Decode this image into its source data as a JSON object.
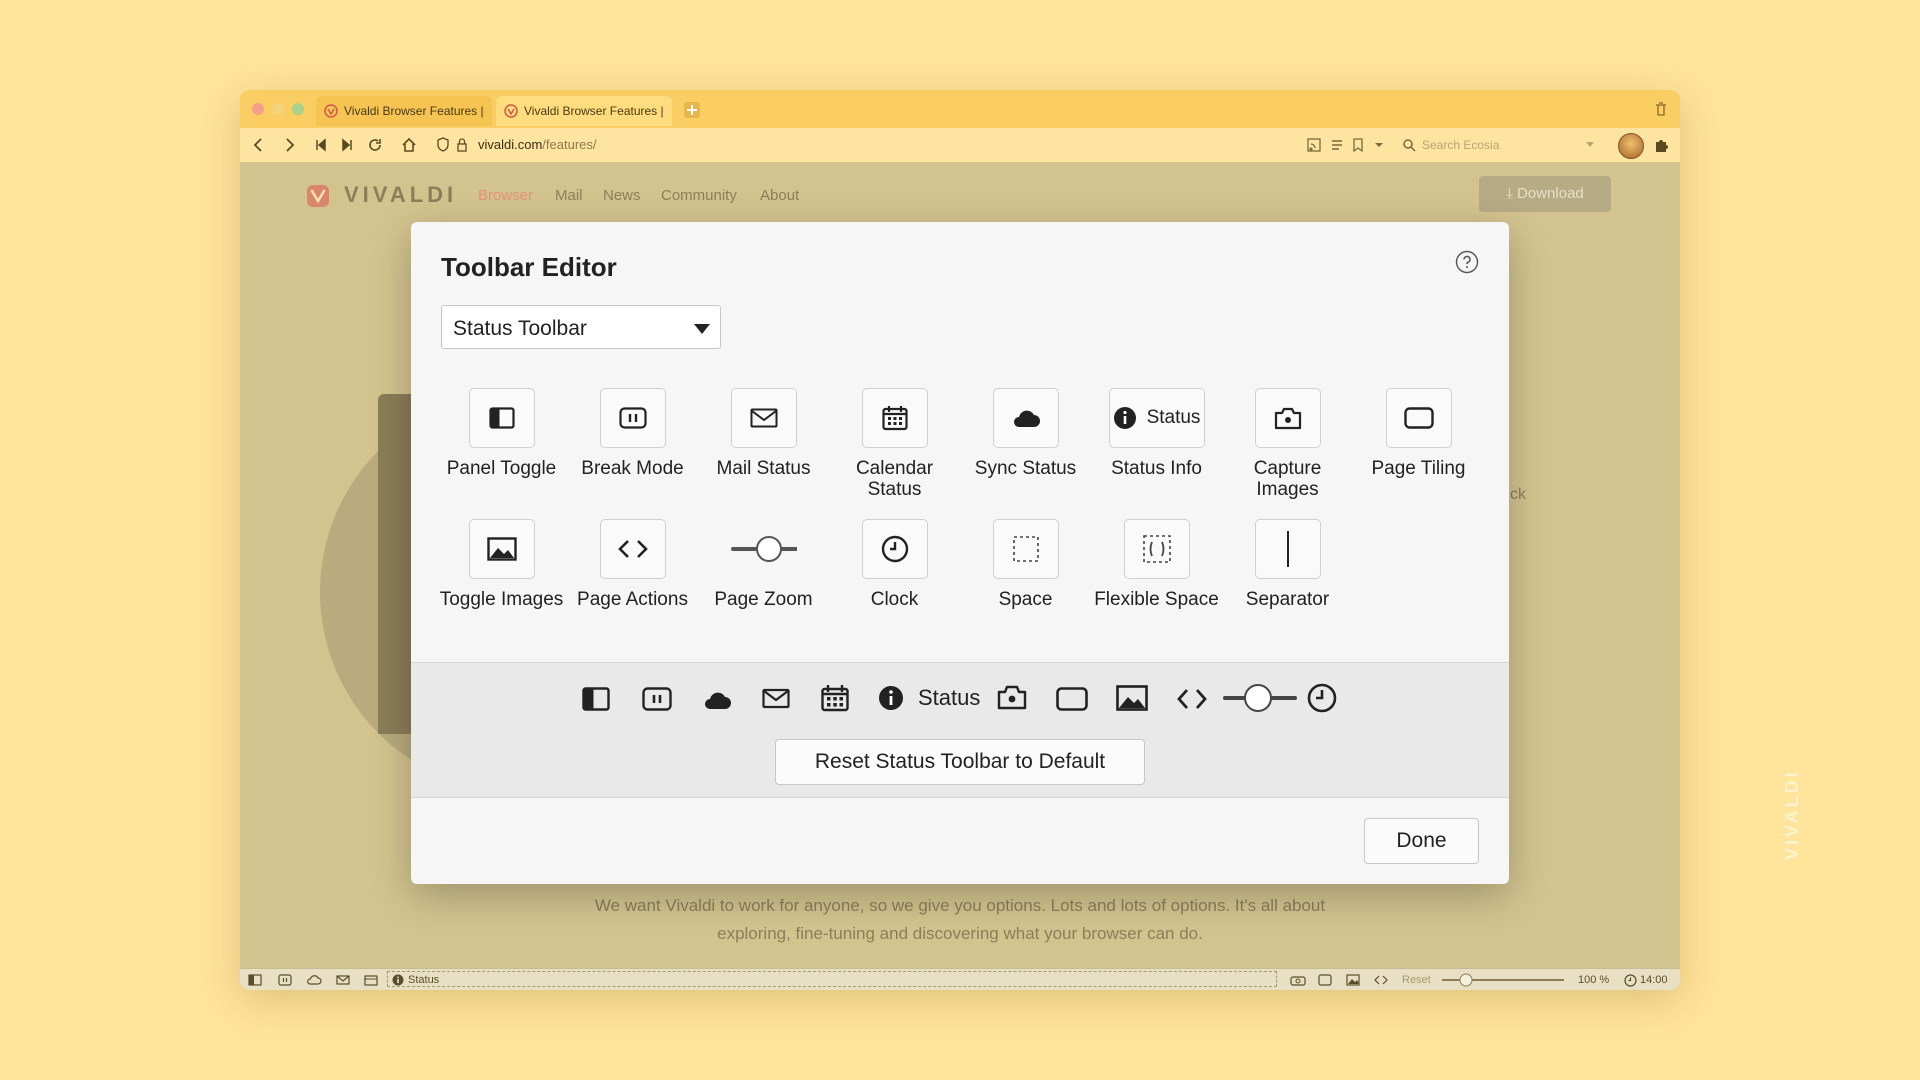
{
  "browser": {
    "tabs": [
      {
        "title": "Vivaldi Browser Features |",
        "active": false
      },
      {
        "title": "Vivaldi Browser Features |",
        "active": true
      }
    ],
    "url_host": "vivaldi.com",
    "url_path": "/features/",
    "search_placeholder": "Search Ecosia"
  },
  "page": {
    "logo": "VIVALDI",
    "nav": [
      "Browser",
      "Mail",
      "News",
      "Community",
      "About"
    ],
    "download_label": "Download",
    "paragraph": "We want Vivaldi to work for anyone, so we give you options. Lots and lots of options. It's all about exploring, fine-tuning and discovering what your browser can do.",
    "fragment": "ck"
  },
  "statusbar": {
    "status_label": "Status",
    "reset_label": "Reset",
    "zoom": "100 %",
    "time": "14:00"
  },
  "dialog": {
    "title": "Toolbar Editor",
    "toolbar_select": "Status Toolbar",
    "items": [
      {
        "label": "Panel Toggle",
        "icon": "panel-toggle-icon"
      },
      {
        "label": "Break Mode",
        "icon": "break-mode-icon"
      },
      {
        "label": "Mail Status",
        "icon": "mail-icon"
      },
      {
        "label": "Calendar Status",
        "icon": "calendar-icon"
      },
      {
        "label": "Sync Status",
        "icon": "cloud-icon"
      },
      {
        "label": "Status Info",
        "icon": "info-icon",
        "inline_text": "Status"
      },
      {
        "label": "Capture Images",
        "icon": "camera-icon"
      },
      {
        "label": "Page Tiling",
        "icon": "page-tiling-icon"
      },
      {
        "label": "Toggle Images",
        "icon": "image-icon"
      },
      {
        "label": "Page Actions",
        "icon": "code-icon"
      },
      {
        "label": "Page Zoom",
        "icon": "zoom-slider-icon"
      },
      {
        "label": "Clock",
        "icon": "clock-icon"
      },
      {
        "label": "Space",
        "icon": "space-icon"
      },
      {
        "label": "Flexible Space",
        "icon": "flexible-space-icon"
      },
      {
        "label": "Separator",
        "icon": "separator-icon"
      }
    ],
    "preview_status": "Status",
    "reset_button": "Reset Status Toolbar to Default",
    "done_button": "Done"
  },
  "watermark": "VIVALDI"
}
